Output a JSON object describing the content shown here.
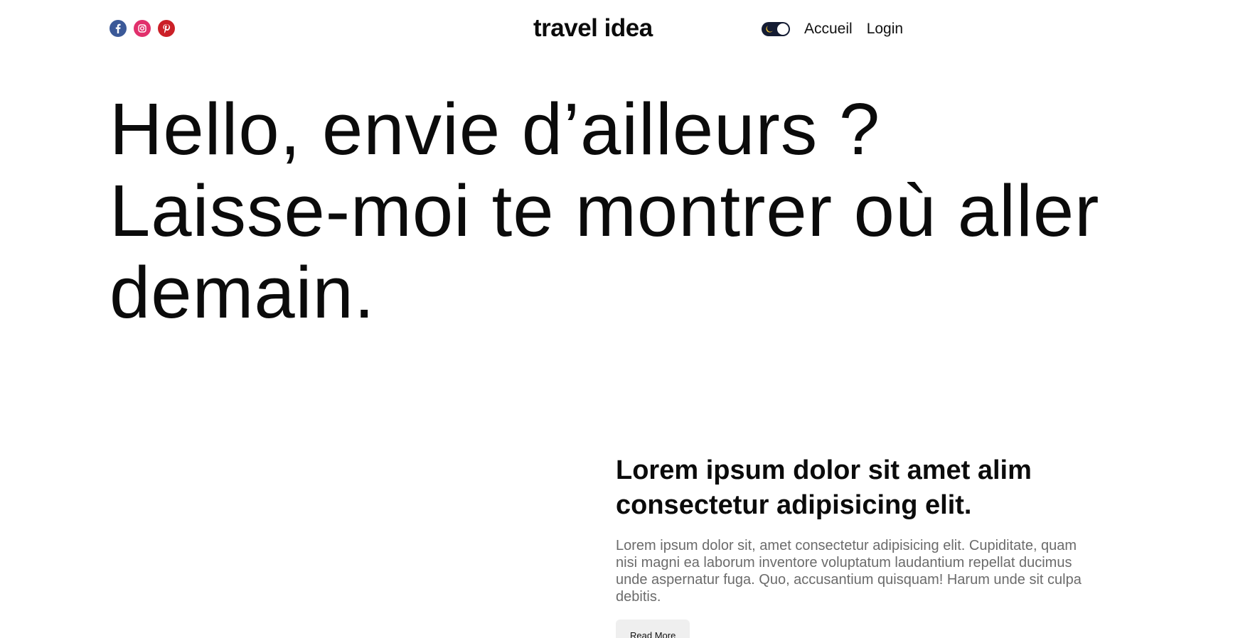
{
  "header": {
    "brand": "travel idea",
    "social": [
      {
        "name": "facebook-icon",
        "color": "#3b5998"
      },
      {
        "name": "instagram-icon",
        "color": "#e1306c"
      },
      {
        "name": "pinterest-icon",
        "color": "#cb2027"
      }
    ],
    "theme_toggle": {
      "icon": "moon-icon",
      "state": "dark"
    },
    "nav": {
      "home_label": "Accueil",
      "login_label": "Login"
    }
  },
  "hero": {
    "line1": "Hello, envie d’ailleurs ?",
    "line2": "Laisse-moi te montrer où aller",
    "line3": "demain."
  },
  "article": {
    "title": "Lorem ipsum dolor sit amet alim consectetur adipisicing elit.",
    "body": "Lorem ipsum dolor sit, amet consectetur adipisicing elit. Cupiditate, quam nisi magni ea laborum inventore voluptatum laudantium repellat ducimus unde aspernatur fuga. Quo, accusantium quisquam! Harum unde sit culpa debitis.",
    "button_label": "Read More"
  }
}
